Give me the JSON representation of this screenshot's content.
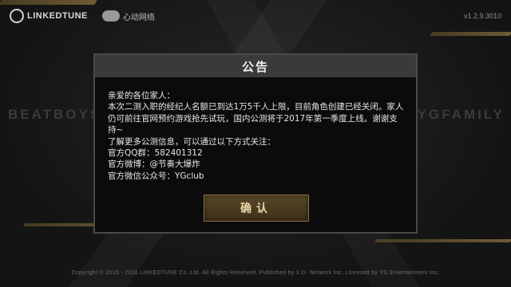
{
  "header": {
    "logo_primary": "LINKEDTUNE",
    "logo_secondary": "心动网络",
    "version": "v1.2.9.3010"
  },
  "background": {
    "left_word": "BEATBOYS",
    "right_word": "YGFAMILY"
  },
  "dialog": {
    "title": "公告",
    "lines": [
      "亲爱的各位家人：",
      "  本次二测入职的经纪人名额已到达1万5千人上限，目前角色创建已经关闭。家人仍可前往官网预约游戏抢先试玩，国内公测将于2017年第一季度上线。谢谢支持~",
      "  了解更多公测信息，可以通过以下方式关注：",
      "官方QQ群：582401312",
      "官方微博：@节奏大爆炸",
      "官方微信公众号：YGclub"
    ],
    "confirm_label": "确认"
  },
  "footer": {
    "copyright": "Copyright © 2015 - 2016 LiNKEDTUNE Co.,Ltd. All Rights Reserved. Published by X.D. Network Inc. Licensed by YG Entertainment Inc."
  },
  "colors": {
    "accent_gold": "#b8944f",
    "dialog_header": "#3a3a3a",
    "background": "#161616"
  }
}
